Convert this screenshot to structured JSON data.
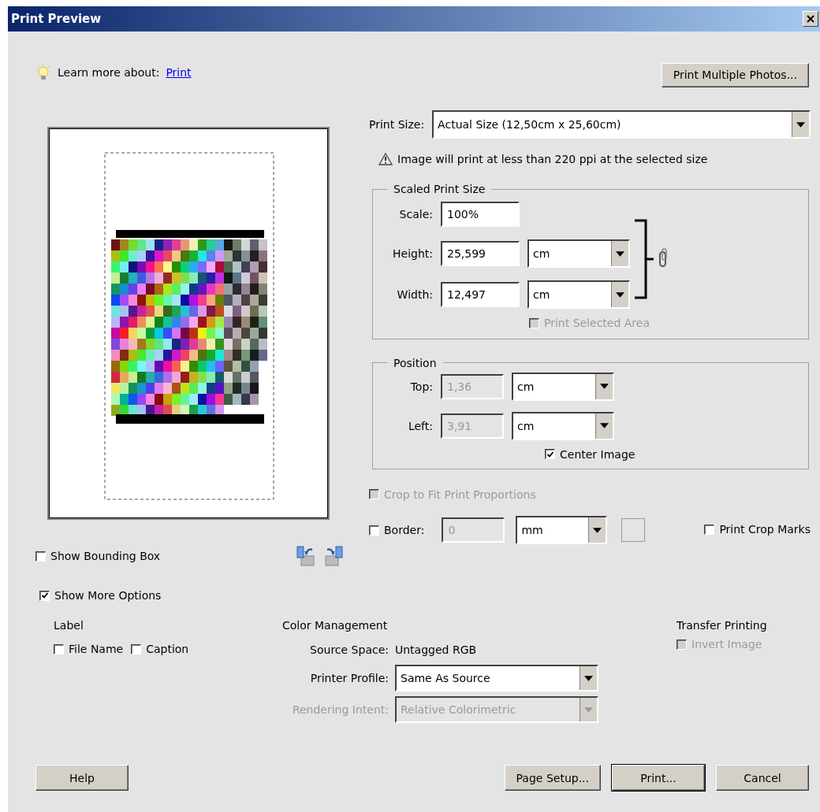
{
  "window": {
    "title": "Print Preview"
  },
  "learn_more": {
    "text": "Learn more about:",
    "link": "Print"
  },
  "print_multiple_button": "Print Multiple Photos...",
  "print_size": {
    "label": "Print Size:",
    "value": "Actual Size (12,50cm x 25,60cm)"
  },
  "warning": "Image will print at less than 220 ppi at the selected size",
  "scaled_print_size": {
    "title": "Scaled Print Size",
    "scale": {
      "label": "Scale:",
      "value": "100%"
    },
    "height": {
      "label": "Height:",
      "value": "25,599",
      "unit": "cm"
    },
    "width": {
      "label": "Width:",
      "value": "12,497",
      "unit": "cm"
    },
    "print_selected_area": {
      "label": "Print Selected Area",
      "checked": false,
      "disabled": true
    }
  },
  "position": {
    "title": "Position",
    "top": {
      "label": "Top:",
      "value": "1,36",
      "unit": "cm",
      "disabled": true
    },
    "left": {
      "label": "Left:",
      "value": "3,91",
      "unit": "cm",
      "disabled": true
    },
    "center_image": {
      "label": "Center Image",
      "checked": true,
      "disabled": false
    }
  },
  "crop_to_fit": {
    "label": "Crop to Fit Print Proportions",
    "checked": false,
    "disabled": true
  },
  "border": {
    "label": "Border:",
    "checked": false,
    "value": "0",
    "unit": "mm",
    "disabled": true
  },
  "print_crop_marks": {
    "label": "Print Crop Marks",
    "checked": false,
    "disabled": false
  },
  "show_bounding_box": {
    "label": "Show Bounding Box",
    "checked": false,
    "disabled": false
  },
  "show_more_options": {
    "label": "Show More Options",
    "checked": true,
    "disabled": false
  },
  "label_section": {
    "title": "Label",
    "options": [
      {
        "label": "File Name",
        "checked": false,
        "disabled": false
      },
      {
        "label": "Caption",
        "checked": false,
        "disabled": false
      }
    ]
  },
  "color_management": {
    "title": "Color Management",
    "source_space": {
      "label": "Source Space:",
      "value": "Untagged RGB"
    },
    "printer_profile": {
      "label": "Printer Profile:",
      "value": "Same As Source",
      "disabled": false
    },
    "rendering_intent": {
      "label": "Rendering Intent:",
      "value": "Relative Colorimetric",
      "disabled": true
    }
  },
  "transfer_printing": {
    "title": "Transfer Printing",
    "invert_image": {
      "label": "Invert Image",
      "checked": false,
      "disabled": true
    }
  },
  "buttons": [
    {
      "label": "Help",
      "kind": "left",
      "default": false
    },
    {
      "label": "Page Setup...",
      "kind": "right",
      "default": false
    },
    {
      "label": "Print...",
      "kind": "right",
      "default": true
    },
    {
      "label": "Cancel",
      "kind": "right",
      "default": false
    }
  ]
}
